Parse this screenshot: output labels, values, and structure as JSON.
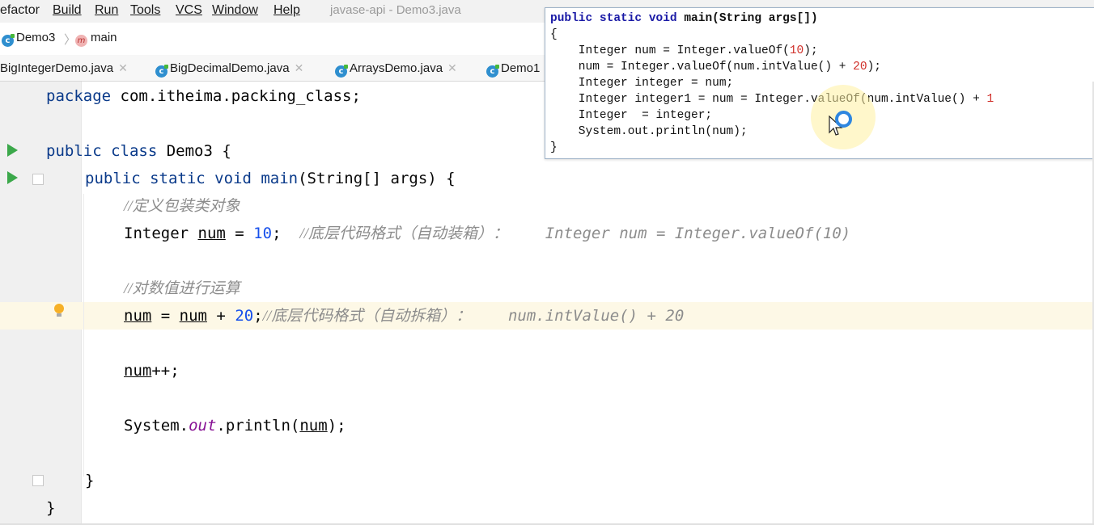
{
  "menubar": {
    "items": [
      {
        "label": "efactor"
      },
      {
        "label": "Build"
      },
      {
        "label": "Run"
      },
      {
        "label": "Tools"
      },
      {
        "label": "VCS"
      },
      {
        "label": "Window"
      },
      {
        "label": "Help"
      }
    ],
    "window_title": "javase-api - Demo3.java"
  },
  "breadcrumb": {
    "class_name": "Demo3",
    "method_name": "main"
  },
  "tabs": [
    {
      "label": "BigIntegerDemo.java"
    },
    {
      "label": "BigDecimalDemo.java"
    },
    {
      "label": "ArraysDemo.java"
    },
    {
      "label": "Demo1"
    }
  ],
  "code": {
    "l1_kw": "package",
    "l1_rest": " com.itheima.packing_class;",
    "l2_kw": "public class",
    "l2_rest": " Demo3 {",
    "l3_kw": "public static void",
    "l3_name": " main",
    "l3_rest": "(String[] args) {",
    "l4_comment": "//定义包装类对象",
    "l5_type": "Integer ",
    "l5_var": "num",
    "l5_eq": " = ",
    "l5_num": "10",
    "l5_semi": ";  ",
    "l5_comment": "//底层代码格式（自动装箱）：",
    "l5_comment2": "    Integer num = Integer.valueOf(10)",
    "l6_comment": "//对数值进行运算",
    "l7_var1": "num",
    "l7_eq": " = ",
    "l7_var2": "num",
    "l7_plus": " + ",
    "l7_num": "20",
    "l7_semi": ";",
    "l7_comment": "//底层代码格式（自动拆箱）：",
    "l7_comment2": "    num.intValue() + 20",
    "l8_var": "num",
    "l8_rest": "++;",
    "l9_sys": "System.",
    "l9_out": "out",
    "l9_print": ".println(",
    "l9_var": "num",
    "l9_end": ");",
    "l10_brace": "}",
    "l11_brace": "}"
  },
  "popup": {
    "l1_kw": "public static void",
    "l1_rest": " main(String args[])",
    "l2": "{",
    "l3_a": "    Integer num = Integer.valueOf(",
    "l3_num": "10",
    "l3_b": ");",
    "l4_a": "    num = Integer.valueOf(num.intValue() + ",
    "l4_num": "20",
    "l4_b": ");",
    "l5": "    Integer integer = num;",
    "l6_a": "    Integer integer1 = num = Integer.valueOf(num.intValue() + ",
    "l6_num": "1",
    "l7": "    Integer  = integer;",
    "l8": "    System.out.println(num);",
    "l9": "}"
  },
  "colors": {
    "keyword": "#0a3a8a",
    "number": "#1750eb",
    "comment": "#8c8c8c",
    "static_field": "#871094",
    "run_icon": "#3ba84a",
    "popup_keyword": "#1a1aa6",
    "popup_number": "#d0302a"
  },
  "icons": [
    "class-icon",
    "method-icon",
    "run-icon",
    "fold-icon",
    "lightbulb-icon",
    "close-icon",
    "mouse-pointer-icon"
  ]
}
